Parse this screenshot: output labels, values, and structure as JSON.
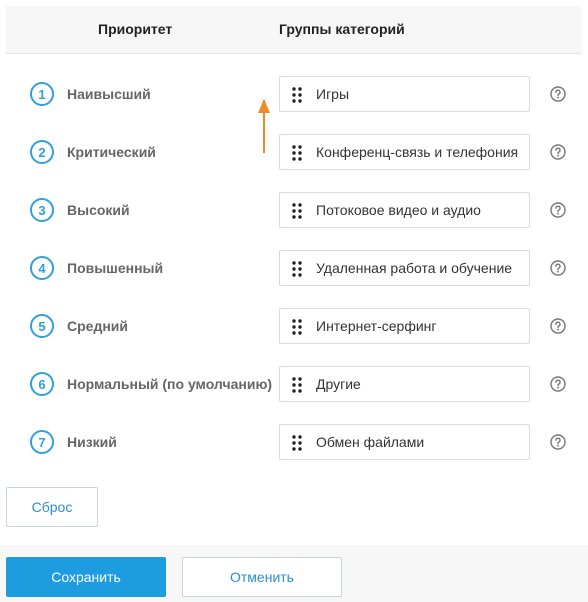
{
  "header": {
    "priority_label": "Приоритет",
    "groups_label": "Группы категорий"
  },
  "rows": [
    {
      "num": "1",
      "priority": "Наивысший",
      "category": "Игры"
    },
    {
      "num": "2",
      "priority": "Критический",
      "category": "Конференц-связь и телефония"
    },
    {
      "num": "3",
      "priority": "Высокий",
      "category": "Потоковое видео и аудио"
    },
    {
      "num": "4",
      "priority": "Повышенный",
      "category": "Удаленная работа и обучение"
    },
    {
      "num": "5",
      "priority": "Средний",
      "category": "Интернет-серфинг"
    },
    {
      "num": "6",
      "priority": "Нормальный (по умолчанию)",
      "category": "Другие"
    },
    {
      "num": "7",
      "priority": "Низкий",
      "category": "Обмен файлами"
    }
  ],
  "buttons": {
    "reset": "Сброс",
    "save": "Сохранить",
    "cancel": "Отменить"
  },
  "colors": {
    "accent": "#1e9ce0",
    "number_circle": "#2fa0dc",
    "arrow": "#f08a24"
  }
}
